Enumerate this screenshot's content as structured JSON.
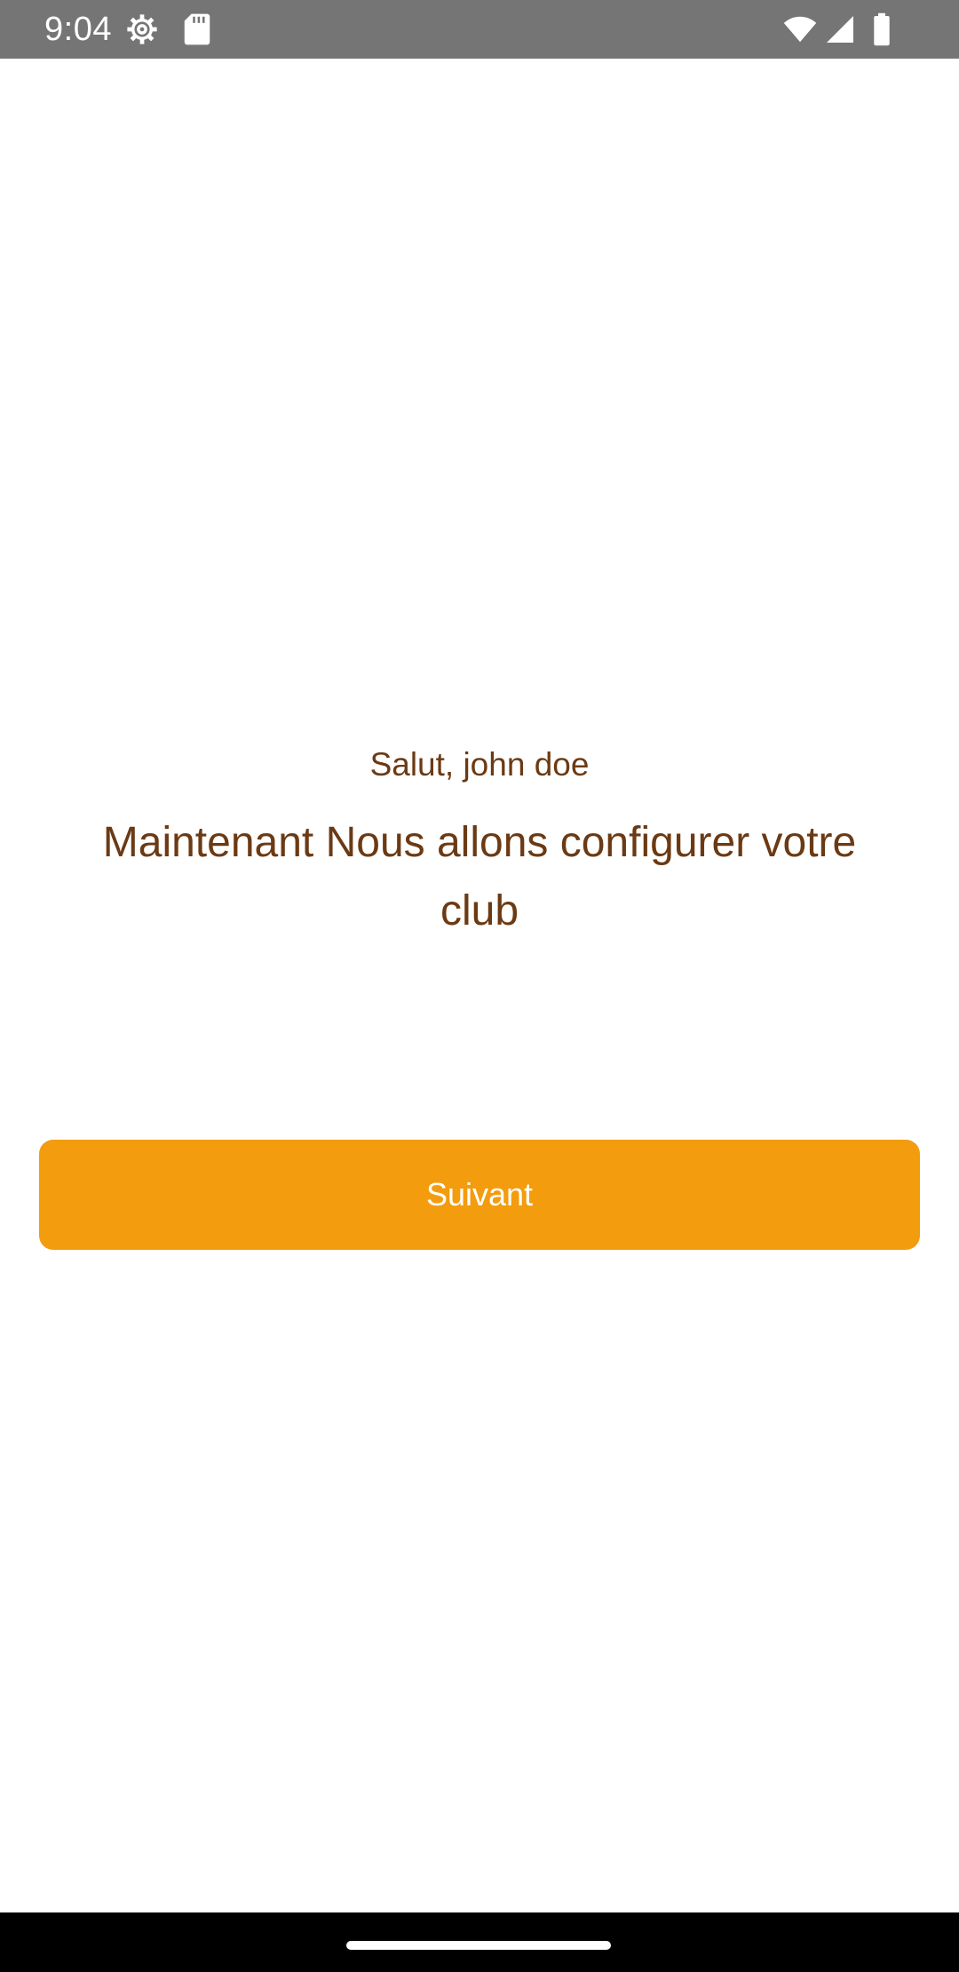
{
  "status_bar": {
    "time": "9:04",
    "icons": [
      "settings-gear-icon",
      "sd-card-icon",
      "wifi-icon",
      "cell-signal-icon",
      "battery-icon"
    ]
  },
  "main": {
    "greeting": "Salut, john doe",
    "headline": "Maintenant Nous allons configurer votre club",
    "next_button_label": "Suivant"
  },
  "colors": {
    "status_bar_bg": "#757575",
    "text_brown": "#6b3a14",
    "button_orange": "#f39c0e",
    "button_text": "#ffffff",
    "nav_bar_bg": "#000000"
  }
}
